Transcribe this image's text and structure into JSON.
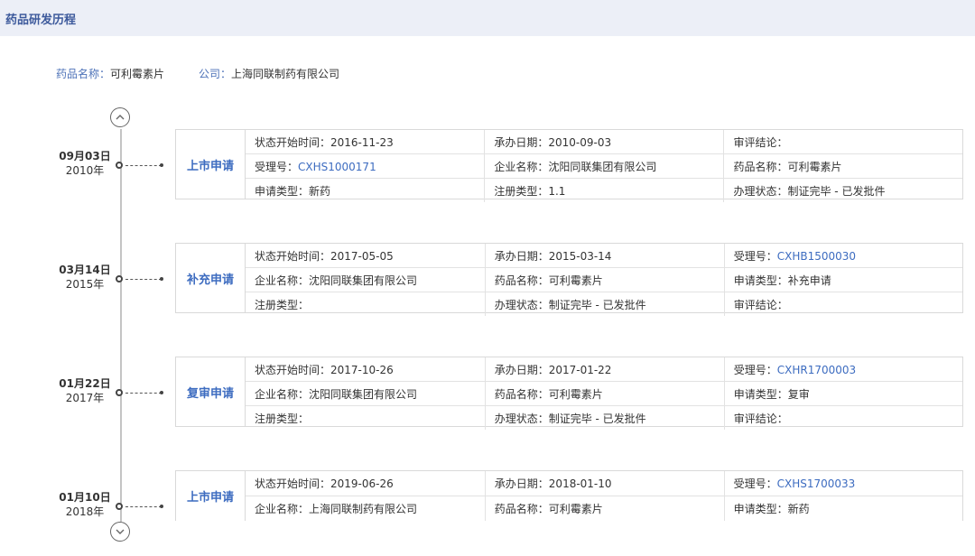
{
  "header": {
    "title": "药品研发历程"
  },
  "drug_info": {
    "name_label": "药品名称：",
    "name_value": "可利霉素片",
    "company_label": "公司：",
    "company_value": "上海同联制药有限公司"
  },
  "entries": [
    {
      "md": "09月03日",
      "year": "2010年",
      "type": "上市申请",
      "rows": [
        [
          {
            "k": "状态开始时间：",
            "v": "2016-11-23"
          },
          {
            "k": "承办日期：",
            "v": "2010-09-03"
          },
          {
            "k": "审评结论：",
            "v": ""
          }
        ],
        [
          {
            "k": "受理号：",
            "v": "CXHS1000171",
            "link": true
          },
          {
            "k": "企业名称：",
            "v": "沈阳同联集团有限公司"
          },
          {
            "k": "药品名称：",
            "v": "可利霉素片"
          }
        ],
        [
          {
            "k": "申请类型：",
            "v": "新药"
          },
          {
            "k": "注册类型：",
            "v": "1.1"
          },
          {
            "k": "办理状态：",
            "v": "制证完毕 - 已发批件"
          }
        ]
      ]
    },
    {
      "md": "03月14日",
      "year": "2015年",
      "type": "补充申请",
      "rows": [
        [
          {
            "k": "状态开始时间：",
            "v": "2017-05-05"
          },
          {
            "k": "承办日期：",
            "v": "2015-03-14"
          },
          {
            "k": "受理号：",
            "v": "CXHB1500030",
            "link": true
          }
        ],
        [
          {
            "k": "企业名称：",
            "v": "沈阳同联集团有限公司"
          },
          {
            "k": "药品名称：",
            "v": "可利霉素片"
          },
          {
            "k": "申请类型：",
            "v": "补充申请"
          }
        ],
        [
          {
            "k": "注册类型：",
            "v": ""
          },
          {
            "k": "办理状态：",
            "v": "制证完毕 - 已发批件"
          },
          {
            "k": "审评结论：",
            "v": ""
          }
        ]
      ]
    },
    {
      "md": "01月22日",
      "year": "2017年",
      "type": "复审申请",
      "rows": [
        [
          {
            "k": "状态开始时间：",
            "v": "2017-10-26"
          },
          {
            "k": "承办日期：",
            "v": "2017-01-22"
          },
          {
            "k": "受理号：",
            "v": "CXHR1700003",
            "link": true
          }
        ],
        [
          {
            "k": "企业名称：",
            "v": "沈阳同联集团有限公司"
          },
          {
            "k": "药品名称：",
            "v": "可利霉素片"
          },
          {
            "k": "申请类型：",
            "v": "复审"
          }
        ],
        [
          {
            "k": "注册类型：",
            "v": ""
          },
          {
            "k": "办理状态：",
            "v": "制证完毕 - 已发批件"
          },
          {
            "k": "审评结论：",
            "v": ""
          }
        ]
      ]
    },
    {
      "md": "01月10日",
      "year": "2018年",
      "type": "上市申请",
      "rows": [
        [
          {
            "k": "状态开始时间：",
            "v": "2019-06-26"
          },
          {
            "k": "承办日期：",
            "v": "2018-01-10"
          },
          {
            "k": "受理号：",
            "v": "CXHS1700033",
            "link": true
          }
        ],
        [
          {
            "k": "企业名称：",
            "v": "上海同联制药有限公司"
          },
          {
            "k": "药品名称：",
            "v": "可利霉素片"
          },
          {
            "k": "申请类型：",
            "v": "新药"
          }
        ]
      ]
    }
  ],
  "nav": {
    "up_icon": "chevron-up-icon",
    "down_icon": "chevron-down-icon"
  }
}
